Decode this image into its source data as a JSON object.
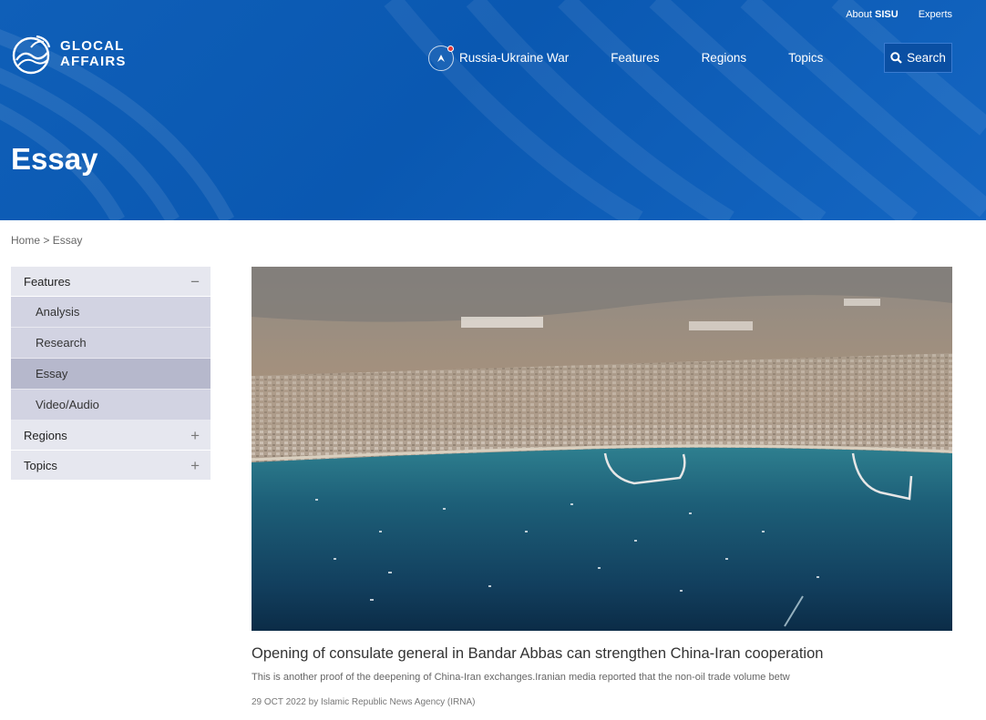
{
  "header": {
    "top_links": {
      "about_prefix": "About",
      "about_strong": "SISU",
      "experts": "Experts"
    },
    "logo": {
      "line1": "GLOCAL",
      "line2": "AFFAIRS"
    },
    "nav": {
      "featured": "Russia-Ukraine War",
      "items": [
        "Features",
        "Regions",
        "Topics"
      ],
      "search_label": "Search"
    },
    "page_title": "Essay"
  },
  "breadcrumb": {
    "home": "Home",
    "separator": ">",
    "current": "Essay"
  },
  "sidebar": {
    "features": {
      "label": "Features",
      "toggle": "−"
    },
    "sub_items": [
      "Analysis",
      "Research",
      "Essay",
      "Video/Audio"
    ],
    "active_sub_index": 2,
    "regions": {
      "label": "Regions",
      "toggle": "+"
    },
    "topics": {
      "label": "Topics",
      "toggle": "+"
    }
  },
  "article": {
    "title": "Opening of consulate general in Bandar Abbas can strengthen China-Iran cooperation",
    "summary": "This is another proof of the deepening of China-Iran exchanges.Iranian media reported that the non-oil trade volume betw",
    "meta": "29 OCT 2022 by Islamic Republic News Agency (IRNA)"
  },
  "colors": {
    "header_blue": "#0a58b1",
    "search_button": "#0a4fa3",
    "sidebar_head": "#e6e7ef",
    "sidebar_sub": "#d2d3e2",
    "sidebar_active": "#b6b8cc"
  },
  "icons": {
    "logo": "globe-wave-logo-icon",
    "war": "ukraine-war-icon",
    "search": "search-icon"
  }
}
